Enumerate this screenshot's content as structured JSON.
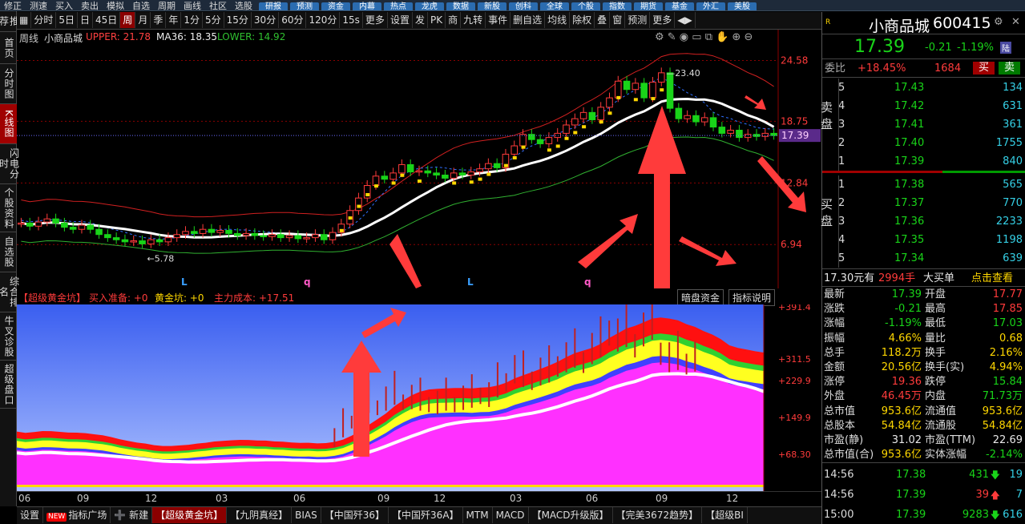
{
  "menu": {
    "items": [
      "修正",
      "测速",
      "买入",
      "卖出",
      "模拟",
      "自选",
      "周期",
      "画线",
      "社区",
      "选股",
      "研报",
      "预测",
      "资金",
      "内幕",
      "热点",
      "龙虎",
      "数据",
      "新股",
      "创科",
      "全球",
      "个股",
      "指数",
      "期货",
      "基金",
      "外汇",
      "美股"
    ]
  },
  "left_tabs": [
    "推荐",
    "首页",
    "分时图",
    "K线图",
    "闪电分时",
    "个股资料",
    "自选股",
    "综合排名",
    "牛叉诊股",
    "超级盘口"
  ],
  "toolbar": {
    "items": [
      "分时",
      "5日",
      "日",
      "45日",
      "周",
      "月",
      "季",
      "年",
      "1分",
      "5分",
      "15分",
      "30分",
      "60分",
      "120分",
      "15s",
      "更多",
      "设置",
      "发",
      "PK",
      "商",
      "九转",
      "事件",
      "删自选",
      "均线",
      "除权",
      "叠",
      "窗",
      "预测",
      "更多"
    ]
  },
  "chart": {
    "period_label": "周线",
    "stock_name": "小商品城",
    "upper": "UPPER: 21.78",
    "ma": "MA36: 18.35",
    "lower": "LOWER: 14.92",
    "price_axis": [
      "24.58",
      "18.75",
      "12.84",
      "6.94"
    ],
    "current_price_tag": "17.39",
    "high_label": "23.40",
    "low_label": "5.78",
    "markers": [
      {
        "text": "L",
        "color": "#3aa0ff"
      },
      {
        "text": "q",
        "color": "#ff5ac8"
      },
      {
        "text": "L",
        "color": "#3aa0ff"
      },
      {
        "text": "q",
        "color": "#ff5ac8"
      }
    ],
    "indicator_title": "【超级黄金坑】",
    "indicator_prepare": "买入准备: +0",
    "indicator_gold": "黄金坑: +0",
    "indicator_cost": "主力成本: +17.51",
    "btn_dark_fund": "暗盘资金",
    "btn_indicator_desc": "指标说明",
    "indicator_axis": [
      "+391.4",
      "+311.5",
      "+229.9",
      "+149.9",
      "+68.30"
    ],
    "x_labels": [
      "06",
      "09",
      "12",
      "03",
      "06",
      "09",
      "12",
      "03",
      "06",
      "09",
      "12"
    ],
    "candles": [
      9,
      8.7,
      9.1,
      9.4,
      9.0,
      8.6,
      8.4,
      8.8,
      8.4,
      7.9,
      7.6,
      7.4,
      7.2,
      7.3,
      7.0,
      7.4,
      7.2,
      7.6,
      7.9,
      8.2,
      8.0,
      8.4,
      8.1,
      8.3,
      8.0,
      7.8,
      8.0,
      7.8,
      7.7,
      7.9,
      7.6,
      7.8,
      7.5,
      7.6,
      7.9,
      7.4,
      8.1,
      8.9,
      10.2,
      11.4,
      12.6,
      13.5,
      13.2,
      13.8,
      14.6,
      13.9,
      14.0,
      13.8,
      13.6,
      13.3,
      13.8,
      13.6,
      13.9,
      14.2,
      14.7,
      14.3,
      15.6,
      16.4,
      17.5,
      17.0,
      16.6,
      17.2,
      17.6,
      18.4,
      19.0,
      19.6,
      18.9,
      20.1,
      21.0,
      22.6,
      21.8,
      22.4,
      21.0,
      22.5,
      23.4,
      20.0,
      19.0,
      19.3,
      18.7,
      19.1,
      18.2,
      17.6,
      17.9,
      17.2,
      17.5,
      17.3,
      17.6,
      17.39
    ]
  },
  "bottom_tabs": {
    "settings": "设置",
    "new_badge": "NEW",
    "items": [
      "指标广场",
      "新建",
      "【超级黄金坑】",
      "【九阴真经】",
      "BIAS",
      "【中国歼36】",
      "【中国歼36A】",
      "MTM",
      "MACD",
      "【MACD升级版】",
      "【完美3672趋势】",
      "【超级BI"
    ]
  },
  "quote": {
    "name": "小商品城",
    "code": "600415",
    "price": "17.39",
    "change": "-0.21",
    "change_pct": "-1.19%",
    "market_badge": "陆",
    "r_badge": "R",
    "weibi_label": "委比",
    "weibi_value": "+18.45%",
    "weicha_value": "1684",
    "buy_btn": "买",
    "sell_btn": "卖",
    "sell_side_label": "卖盘",
    "buy_side_label": "买盘",
    "asks": [
      {
        "level": "5",
        "price": "17.43",
        "vol": "134"
      },
      {
        "level": "4",
        "price": "17.42",
        "vol": "631"
      },
      {
        "level": "3",
        "price": "17.41",
        "vol": "361"
      },
      {
        "level": "2",
        "price": "17.40",
        "vol": "1755"
      },
      {
        "level": "1",
        "price": "17.39",
        "vol": "840"
      }
    ],
    "bids": [
      {
        "level": "1",
        "price": "17.38",
        "vol": "565"
      },
      {
        "level": "2",
        "price": "17.37",
        "vol": "770"
      },
      {
        "level": "3",
        "price": "17.36",
        "vol": "2233"
      },
      {
        "level": "4",
        "price": "17.35",
        "vol": "1198"
      },
      {
        "level": "5",
        "price": "17.34",
        "vol": "639"
      }
    ],
    "big_order_price": "17.30元有",
    "big_order_vol": "2994手",
    "big_order_type": "大买单",
    "big_order_link": "点击查看",
    "stats": [
      {
        "l": "最新",
        "v": "17.39",
        "vc": "green",
        "l2": "开盘",
        "v2": "17.77",
        "v2c": "red"
      },
      {
        "l": "涨跌",
        "v": "-0.21",
        "vc": "green",
        "l2": "最高",
        "v2": "17.85",
        "v2c": "red"
      },
      {
        "l": "涨幅",
        "v": "-1.19%",
        "vc": "green",
        "l2": "最低",
        "v2": "17.03",
        "v2c": "green"
      },
      {
        "l": "振幅",
        "v": "4.66%",
        "vc": "yellow",
        "l2": "量比",
        "v2": "0.68",
        "v2c": "yellow"
      },
      {
        "l": "总手",
        "v": "118.2万",
        "vc": "yellow",
        "l2": "换手",
        "v2": "2.16%",
        "v2c": "yellow"
      },
      {
        "l": "金额",
        "v": "20.56亿",
        "vc": "yellow",
        "l2": "换手(实)",
        "v2": "4.94%",
        "v2c": "yellow"
      },
      {
        "l": "涨停",
        "v": "19.36",
        "vc": "red",
        "l2": "跌停",
        "v2": "15.84",
        "v2c": "green"
      },
      {
        "l": "外盘",
        "v": "46.45万",
        "vc": "red",
        "l2": "内盘",
        "v2": "71.73万",
        "v2c": "green"
      },
      {
        "l": "总市值",
        "v": "953.6亿",
        "vc": "yellow",
        "l2": "流通值",
        "v2": "953.6亿",
        "v2c": "yellow"
      },
      {
        "l": "总股本",
        "v": "54.84亿",
        "vc": "yellow",
        "l2": "流通股",
        "v2": "54.84亿",
        "v2c": "yellow"
      },
      {
        "l": "市盈(静)",
        "v": "31.02",
        "vc": "white",
        "l2": "市盈(TTM)",
        "v2": "22.69",
        "v2c": "white"
      },
      {
        "l": "总市值(合)",
        "v": "953.6亿",
        "vc": "yellow",
        "l2": "实体涨幅",
        "v2": "-2.14%",
        "v2c": "green"
      }
    ],
    "ticks": [
      {
        "time": "14:56",
        "price": "17.38",
        "vol": "431",
        "dir": "down",
        "n": "19"
      },
      {
        "time": "14:56",
        "price": "17.39",
        "vol": "39",
        "dir": "up",
        "n": "7"
      },
      {
        "time": "15:00",
        "price": "17.39",
        "vol": "9283",
        "dir": "down",
        "n": "616"
      }
    ]
  },
  "colors": {
    "up": "#ff3b3b",
    "down": "#19d419",
    "accent": "#8b0000",
    "ma": "#ffffff",
    "upper": "#ff4040",
    "lower": "#30c030"
  }
}
